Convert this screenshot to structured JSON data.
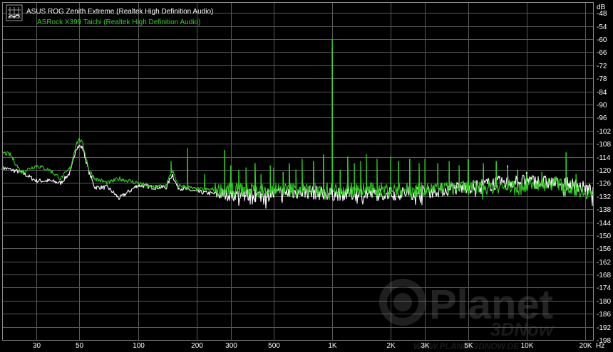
{
  "chart_data": {
    "type": "line",
    "title": "",
    "xlabel": "Hz",
    "ylabel": "dB",
    "x_scale": "log",
    "xlim": [
      20,
      22000
    ],
    "ylim": [
      -198,
      -43
    ],
    "grid": true,
    "legend_placement": "top-left",
    "x_ticks": [
      30,
      50,
      100,
      200,
      300,
      500,
      1000,
      2000,
      3000,
      5000,
      10000,
      20000
    ],
    "x_tick_labels": [
      "30",
      "50",
      "100",
      "200",
      "300",
      "500",
      "1K",
      "2K",
      "3K",
      "5K",
      "10K",
      "20K"
    ],
    "y_ticks": [
      -48,
      -54,
      -60,
      -66,
      -72,
      -78,
      -84,
      -90,
      -96,
      -102,
      -108,
      -114,
      -120,
      -126,
      -132,
      -138,
      -144,
      -150,
      -156,
      -162,
      -168,
      -174,
      -180,
      -186,
      -192,
      -198
    ],
    "y_tick_labels": [
      "-48",
      "-54",
      "-60",
      "-66",
      "-72",
      "-78",
      "-84",
      "-90",
      "-96",
      "-102",
      "-108",
      "-114",
      "-120",
      "-126",
      "-132",
      "-138",
      "-144",
      "-150",
      "-156",
      "-162",
      "-168",
      "-174",
      "-180",
      "-186",
      "-192",
      "-198"
    ],
    "series": [
      {
        "name": "ASUS ROG Zenith Extreme (Realtek High Definition Audio)",
        "color": "#ffffff",
        "points": [
          [
            20,
            -119
          ],
          [
            25,
            -121
          ],
          [
            30,
            -125
          ],
          [
            35,
            -125
          ],
          [
            40,
            -126
          ],
          [
            45,
            -121
          ],
          [
            48,
            -110
          ],
          [
            50,
            -109
          ],
          [
            52,
            -110
          ],
          [
            56,
            -121
          ],
          [
            60,
            -128
          ],
          [
            70,
            -128
          ],
          [
            80,
            -133
          ],
          [
            100,
            -127
          ],
          [
            120,
            -128
          ],
          [
            140,
            -128
          ],
          [
            150,
            -122
          ],
          [
            160,
            -128
          ],
          [
            180,
            -129
          ],
          [
            200,
            -130
          ],
          [
            250,
            -131
          ],
          [
            300,
            -131
          ],
          [
            400,
            -132
          ],
          [
            500,
            -131
          ],
          [
            700,
            -130
          ],
          [
            1000,
            -131
          ],
          [
            1500,
            -131
          ],
          [
            2000,
            -131
          ],
          [
            3000,
            -130
          ],
          [
            5000,
            -128
          ],
          [
            7000,
            -126
          ],
          [
            10000,
            -125
          ],
          [
            14000,
            -126
          ],
          [
            18000,
            -127
          ],
          [
            22000,
            -130
          ]
        ],
        "spikes": [
          [
            150,
            -123
          ],
          [
            180,
            -115
          ],
          [
            300,
            -128
          ],
          [
            350,
            -130
          ],
          [
            400,
            -127
          ],
          [
            480,
            -129
          ],
          [
            600,
            -126
          ],
          [
            700,
            -125
          ],
          [
            800,
            -126
          ],
          [
            1000,
            -64
          ],
          [
            1200,
            -127
          ],
          [
            1500,
            -126
          ],
          [
            2000,
            -125
          ],
          [
            3000,
            -124
          ],
          [
            4000,
            -121
          ],
          [
            5000,
            -120
          ],
          [
            6000,
            -119
          ],
          [
            7000,
            -117
          ],
          [
            8000,
            -118
          ],
          [
            9000,
            -120
          ],
          [
            10000,
            -121
          ],
          [
            13000,
            -124
          ],
          [
            16000,
            -115
          ],
          [
            18000,
            -124
          ]
        ]
      },
      {
        "name": "ASRock X399 Taichi (Realtek High Definition Audio)",
        "color": "#2ed21e",
        "points": [
          [
            20,
            -112
          ],
          [
            22,
            -113
          ],
          [
            25,
            -121
          ],
          [
            30,
            -118
          ],
          [
            35,
            -120
          ],
          [
            40,
            -124
          ],
          [
            45,
            -119
          ],
          [
            48,
            -108
          ],
          [
            50,
            -106
          ],
          [
            52,
            -108
          ],
          [
            56,
            -120
          ],
          [
            60,
            -124
          ],
          [
            70,
            -126
          ],
          [
            80,
            -124
          ],
          [
            100,
            -126
          ],
          [
            120,
            -128
          ],
          [
            140,
            -127
          ],
          [
            150,
            -120
          ],
          [
            160,
            -127
          ],
          [
            180,
            -128
          ],
          [
            200,
            -129
          ],
          [
            250,
            -129
          ],
          [
            300,
            -129
          ],
          [
            400,
            -129
          ],
          [
            500,
            -129
          ],
          [
            700,
            -129
          ],
          [
            1000,
            -129
          ],
          [
            1500,
            -129
          ],
          [
            2000,
            -129
          ],
          [
            3000,
            -129
          ],
          [
            5000,
            -128
          ],
          [
            7000,
            -128
          ],
          [
            10000,
            -127
          ],
          [
            14000,
            -126
          ],
          [
            18000,
            -129
          ],
          [
            22000,
            -131
          ]
        ],
        "spikes": [
          [
            148,
            -116
          ],
          [
            150,
            -121
          ],
          [
            180,
            -110
          ],
          [
            220,
            -122
          ],
          [
            280,
            -111
          ],
          [
            300,
            -118
          ],
          [
            330,
            -120
          ],
          [
            360,
            -119
          ],
          [
            400,
            -117
          ],
          [
            430,
            -122
          ],
          [
            480,
            -118
          ],
          [
            500,
            -119
          ],
          [
            560,
            -121
          ],
          [
            600,
            -117
          ],
          [
            650,
            -120
          ],
          [
            700,
            -115
          ],
          [
            800,
            -116
          ],
          [
            900,
            -113
          ],
          [
            1000,
            -60
          ],
          [
            1100,
            -120
          ],
          [
            1200,
            -114
          ],
          [
            1300,
            -117
          ],
          [
            1400,
            -116
          ],
          [
            1500,
            -113
          ],
          [
            1700,
            -115
          ],
          [
            2000,
            -114
          ],
          [
            2200,
            -116
          ],
          [
            2500,
            -115
          ],
          [
            2800,
            -117
          ],
          [
            3000,
            -115
          ],
          [
            3500,
            -117
          ],
          [
            4000,
            -116
          ],
          [
            4500,
            -118
          ],
          [
            5000,
            -115
          ],
          [
            6000,
            -117
          ],
          [
            7000,
            -116
          ],
          [
            8000,
            -119
          ],
          [
            9000,
            -120
          ],
          [
            10000,
            -122
          ],
          [
            12000,
            -121
          ],
          [
            16000,
            -112
          ],
          [
            18000,
            -122
          ]
        ]
      }
    ]
  },
  "watermark": {
    "brand": "Planet",
    "sub": "3DNow",
    "url": "WWW.PLANET3DNOW.DE"
  }
}
